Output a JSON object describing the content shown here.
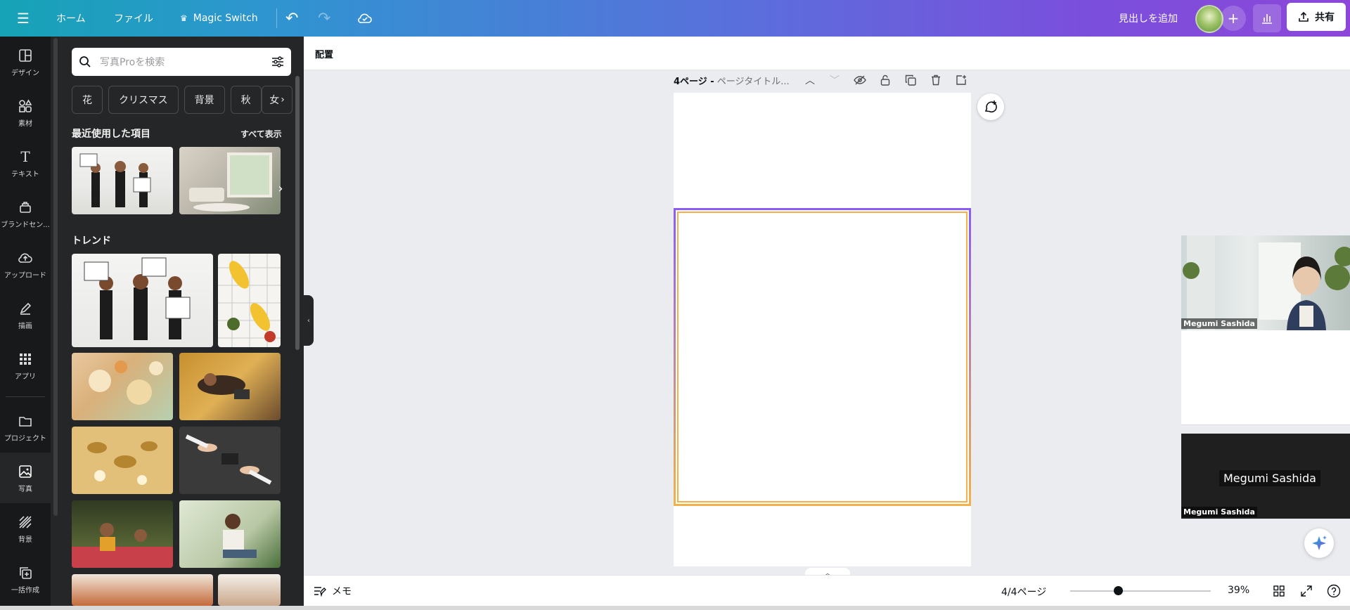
{
  "topbar": {
    "home": "ホーム",
    "file": "ファイル",
    "magic_switch": "Magic Switch",
    "add_heading": "見出しを追加",
    "share": "共有"
  },
  "rail": {
    "items": [
      "デザイン",
      "素材",
      "テキスト",
      "ブランドセン...",
      "アップロード",
      "描画",
      "アプリ",
      "プロジェクト",
      "写真",
      "背景",
      "一括作成"
    ]
  },
  "panel": {
    "search_placeholder": "写真Proを検索",
    "chips": [
      "花",
      "クリスマス",
      "背景",
      "秋"
    ],
    "chip_more": "女",
    "recent_title": "最近使用した項目",
    "see_all": "すべて表示",
    "trend_title": "トレンド"
  },
  "editor": {
    "arrange": "配置",
    "page_label": "4ページ -",
    "page_title": "ページタイトル..."
  },
  "video": {
    "cam_name": "Megumi Sashida",
    "center_name": "Megumi Sashida",
    "bottom_name": "Megumi Sashida"
  },
  "bottombar": {
    "notes": "メモ",
    "pages": "4/4ページ",
    "zoom": "39%",
    "zoom_fraction": 0.39
  },
  "colors": {
    "top_gradient_start": "#16a3b6",
    "top_gradient_end": "#8c47d8",
    "panel_bg": "#252627",
    "rail_bg": "#18191b",
    "canvas_bg": "#ebecf0",
    "page_border": "#f6b04a"
  }
}
